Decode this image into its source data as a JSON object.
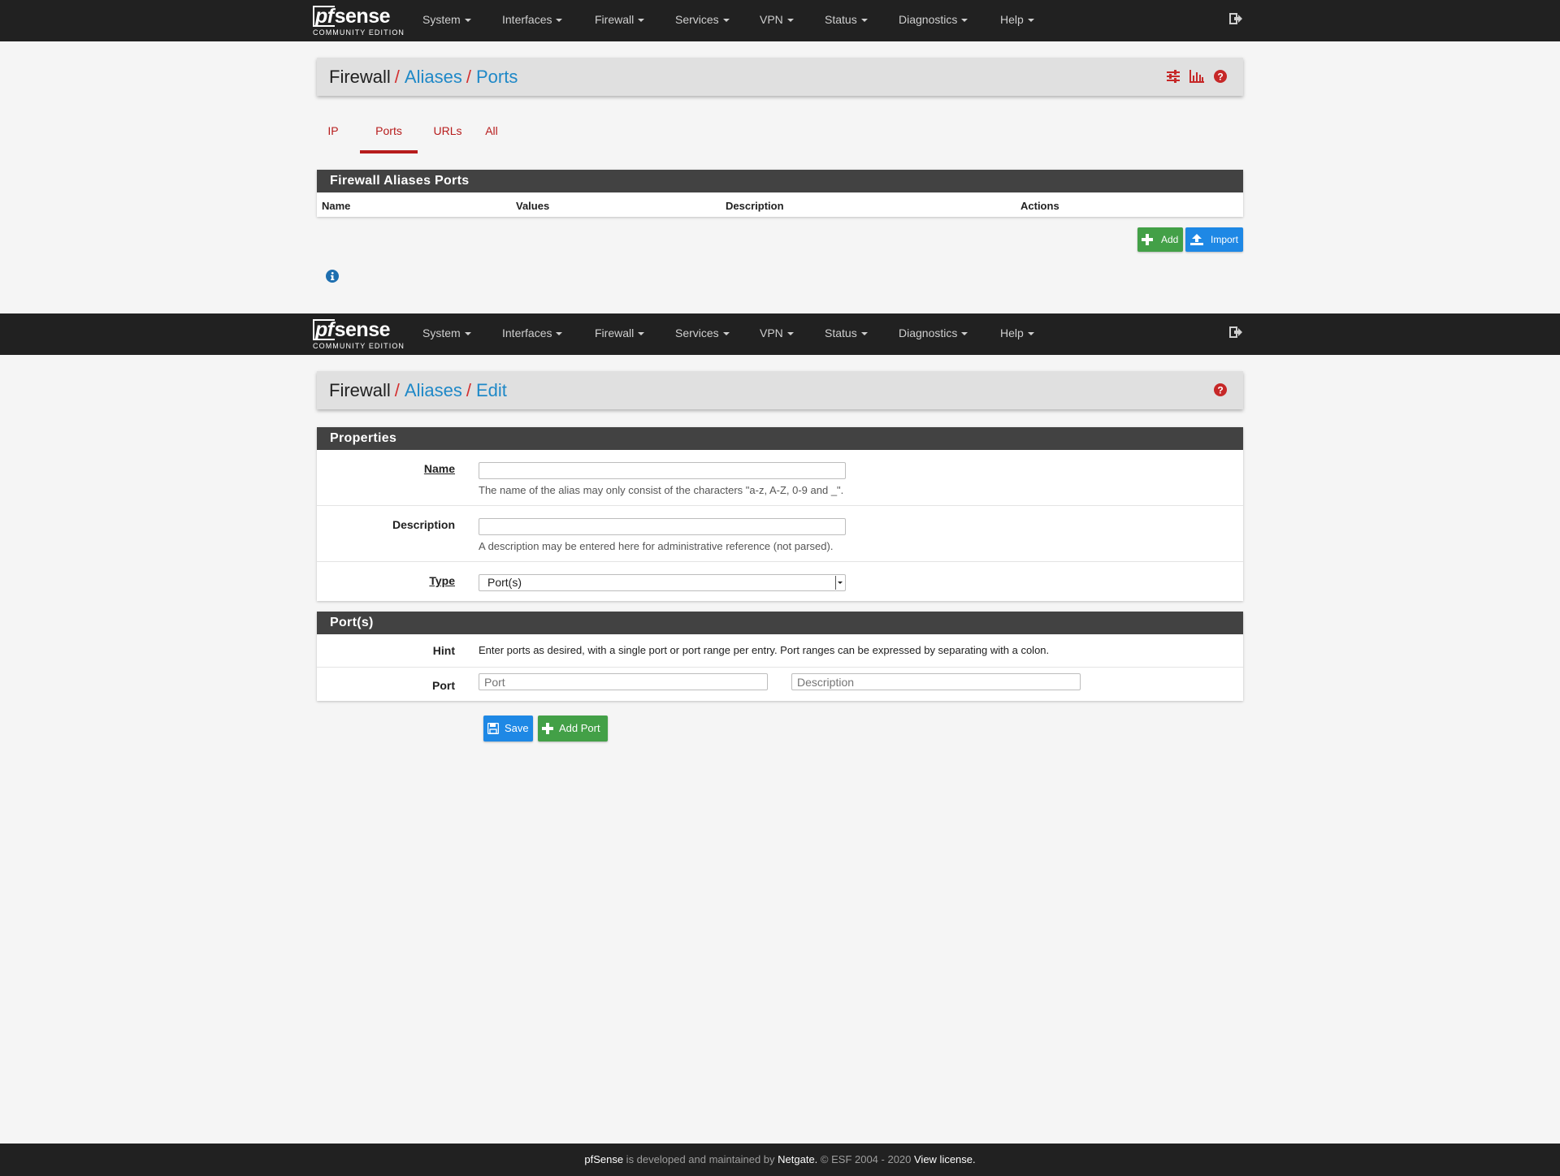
{
  "nav": {
    "brand": "pfsense",
    "brand_pf": "pf",
    "brand_rest": "sense",
    "brand_sub": "COMMUNITY EDITION",
    "menu": [
      "System",
      "Interfaces",
      "Firewall",
      "Services",
      "VPN",
      "Status",
      "Diagnostics",
      "Help"
    ]
  },
  "list_page": {
    "breadcrumb": [
      "Firewall",
      "Aliases",
      "Ports"
    ],
    "tabs": [
      "IP",
      "Ports",
      "URLs",
      "All"
    ],
    "active_tab": "Ports",
    "panel_title": "Firewall Aliases Ports",
    "columns": [
      "Name",
      "Values",
      "Description",
      "Actions"
    ],
    "add_label": "Add",
    "import_label": "Import"
  },
  "edit_page": {
    "breadcrumb": [
      "Firewall",
      "Aliases",
      "Edit"
    ],
    "properties_title": "Properties",
    "name_label": "Name",
    "name_value": "",
    "name_help": "The name of the alias may only consist of the characters \"a-z, A-Z, 0-9 and _\".",
    "description_label": "Description",
    "description_value": "",
    "description_help": "A description may be entered here for administrative reference (not parsed).",
    "type_label": "Type",
    "type_value": "Port(s)",
    "ports_title": "Port(s)",
    "hint_label": "Hint",
    "hint_text": "Enter ports as desired, with a single port or port range per entry. Port ranges can be expressed by separating with a colon.",
    "port_label": "Port",
    "port_placeholder": "Port",
    "port_desc_placeholder": "Description",
    "save_label": "Save",
    "add_port_label": "Add Port"
  },
  "footer": {
    "brand": "pfSense",
    "text1": " is developed and maintained by ",
    "company": "Netgate.",
    "text2": " © ESF 2004 - 2020 ",
    "license": "View license."
  },
  "colors": {
    "navbar": "#212121",
    "accent_red": "#b71c1c",
    "link_blue": "#1e88c7",
    "panel_head": "#424242",
    "success": "#43a047",
    "primary": "#1e88e5"
  }
}
